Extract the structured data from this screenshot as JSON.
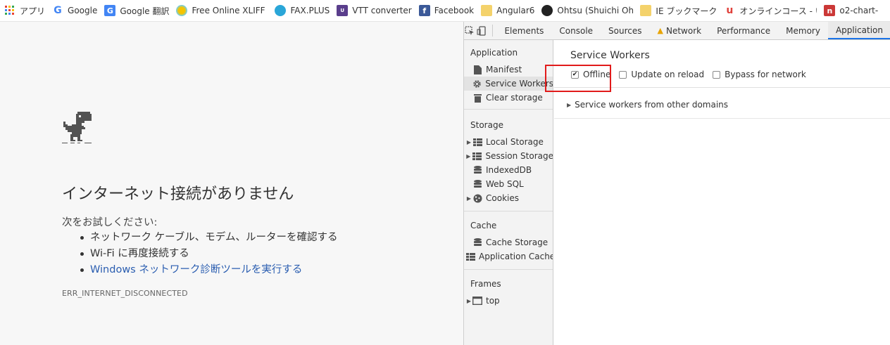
{
  "bookmarks": [
    {
      "label": "アプリ",
      "icon": "apps-grid-icon",
      "color": "#4285f4"
    },
    {
      "label": "Google",
      "icon": "google-icon",
      "color": "#4285f4"
    },
    {
      "label": "Google 翻訳",
      "icon": "google-translate-icon",
      "color": "#4285f4"
    },
    {
      "label": "Free Online XLIFF Ed",
      "icon": "xliff-icon",
      "color": "#f5c400"
    },
    {
      "label": "FAX.PLUS",
      "icon": "fax-plus-icon",
      "color": "#2aa6d8"
    },
    {
      "label": "VTT converter",
      "icon": "vtt-icon",
      "color": "#5a3e8c"
    },
    {
      "label": "Facebook",
      "icon": "facebook-icon",
      "color": "#3b5998"
    },
    {
      "label": "Angular6",
      "icon": "folder-icon",
      "color": "#f4d26b"
    },
    {
      "label": "Ohtsu (Shuichi Ohtsu",
      "icon": "github-icon",
      "color": "#222222"
    },
    {
      "label": "IE ブックマーク",
      "icon": "folder-icon",
      "color": "#f4d26b"
    },
    {
      "label": "オンラインコース - いつで",
      "icon": "udemy-icon",
      "color": "#e0413b"
    },
    {
      "label": "o2-chart-",
      "icon": "npm-icon",
      "color": "#cb3837"
    }
  ],
  "error_page": {
    "title": "インターネット接続がありません",
    "try_label": "次をお試しください:",
    "suggestions": [
      "ネットワーク ケーブル、モデム、ルーターを確認する",
      "Wi-Fi に再度接続する",
      "Windows ネットワーク診断ツールを実行する"
    ],
    "error_code": "ERR_INTERNET_DISCONNECTED"
  },
  "devtools": {
    "tabs": [
      "Elements",
      "Console",
      "Sources",
      "Network",
      "Performance",
      "Memory",
      "Application"
    ],
    "active_tab": "Application",
    "sidebar": {
      "application_title": "Application",
      "application_items": [
        "Manifest",
        "Service Workers",
        "Clear storage"
      ],
      "storage_title": "Storage",
      "storage_items": [
        "Local Storage",
        "Session Storage",
        "IndexedDB",
        "Web SQL",
        "Cookies"
      ],
      "cache_title": "Cache",
      "cache_items": [
        "Cache Storage",
        "Application Cache"
      ],
      "frames_title": "Frames",
      "frames_items": [
        "top"
      ]
    },
    "main": {
      "title": "Service Workers",
      "options": [
        {
          "label": "Offline",
          "checked": true
        },
        {
          "label": "Update on reload",
          "checked": false
        },
        {
          "label": "Bypass for network",
          "checked": false
        }
      ],
      "other_domains": "Service workers from other domains"
    }
  },
  "colors": {
    "highlight": "#e11b1b",
    "active_tab": "#1a73e8",
    "link": "#2a5db0"
  }
}
